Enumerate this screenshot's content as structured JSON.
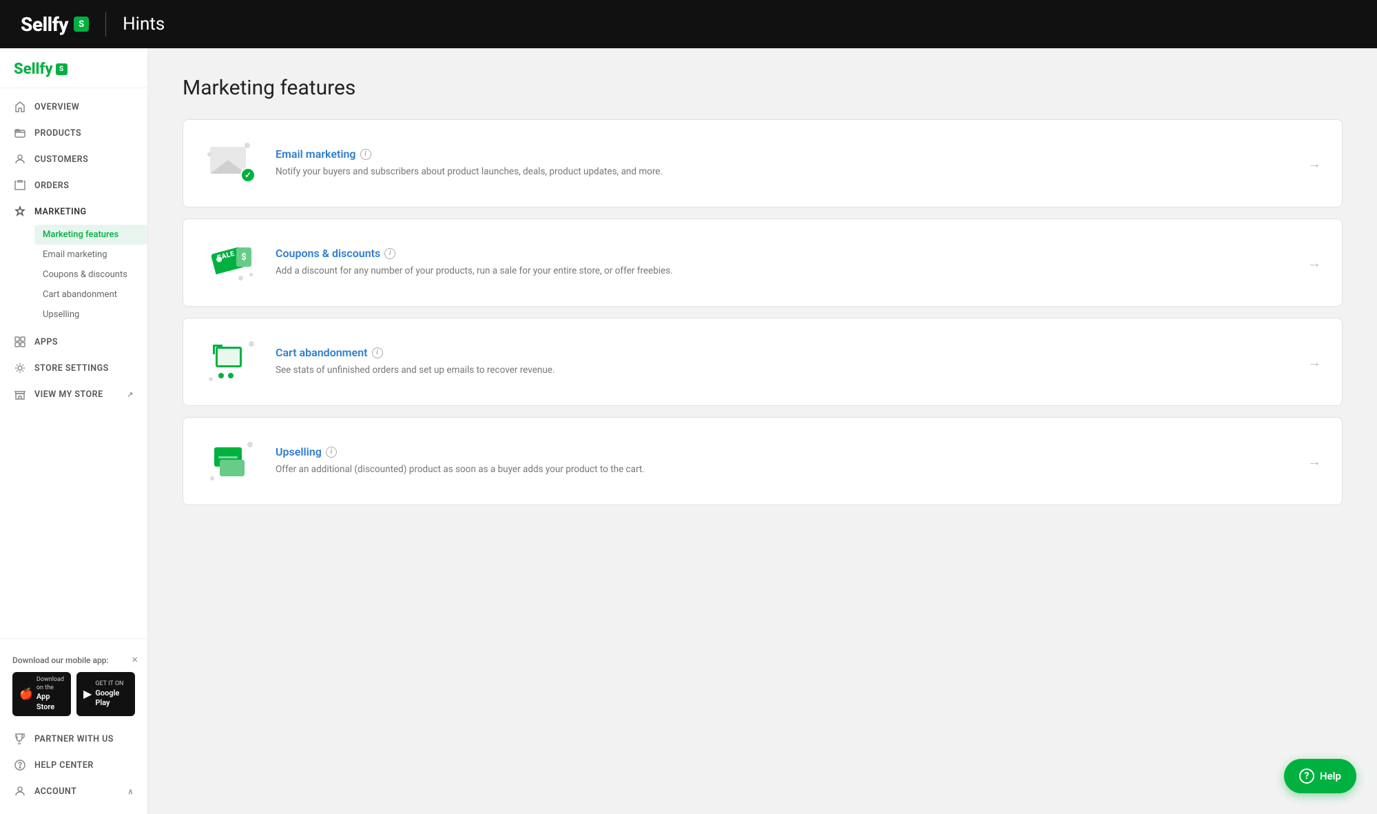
{
  "header": {
    "logo_text": "Sellfy",
    "logo_badge": "S",
    "divider": true,
    "title": "Hints"
  },
  "sidebar": {
    "logo_text": "Sellfy",
    "logo_badge": "S",
    "nav_items": [
      {
        "id": "overview",
        "label": "OVERVIEW",
        "icon": "home-icon"
      },
      {
        "id": "products",
        "label": "PRODUCTS",
        "icon": "folder-icon"
      },
      {
        "id": "customers",
        "label": "CUSTOMERS",
        "icon": "person-icon"
      },
      {
        "id": "orders",
        "label": "ORDERS",
        "icon": "cart-icon"
      },
      {
        "id": "marketing",
        "label": "MARKETING",
        "icon": "bell-icon",
        "active": true
      }
    ],
    "marketing_sub_items": [
      {
        "id": "marketing-features",
        "label": "Marketing features",
        "active": true
      },
      {
        "id": "email-marketing",
        "label": "Email marketing"
      },
      {
        "id": "coupons-discounts",
        "label": "Coupons & discounts"
      },
      {
        "id": "cart-abandonment",
        "label": "Cart abandonment"
      },
      {
        "id": "upselling",
        "label": "Upselling"
      }
    ],
    "bottom_nav": [
      {
        "id": "apps",
        "label": "APPS",
        "icon": "grid-icon"
      },
      {
        "id": "store-settings",
        "label": "STORE SETTINGS",
        "icon": "gear-icon"
      },
      {
        "id": "view-my-store",
        "label": "VIEW MY STORE",
        "icon": "store-icon"
      }
    ],
    "mobile_app": {
      "label": "Download our mobile app:",
      "app_store": {
        "sub": "Download on the",
        "main": "App Store",
        "icon": "🍎"
      },
      "play_store": {
        "sub": "GET IT ON",
        "main": "Google Play",
        "icon": "▶"
      }
    },
    "partner_nav": {
      "label": "PARTNER WITH US",
      "icon": "trophy-icon"
    },
    "help_center_nav": {
      "label": "HELP CENTER",
      "icon": "help-icon"
    },
    "account_nav": {
      "label": "ACCOUNT",
      "icon": "user-icon"
    }
  },
  "main": {
    "page_title": "Marketing features",
    "features": [
      {
        "id": "email-marketing",
        "name": "Email marketing",
        "description": "Notify your buyers and subscribers about product launches, deals, product updates, and more.",
        "icon_type": "email"
      },
      {
        "id": "coupons-discounts",
        "name": "Coupons & discounts",
        "description": "Add a discount for any number of your products, run a sale for your entire store, or offer freebies.",
        "icon_type": "coupon"
      },
      {
        "id": "cart-abandonment",
        "name": "Cart abandonment",
        "description": "See stats of unfinished orders and set up emails to recover revenue.",
        "icon_type": "cart"
      },
      {
        "id": "upselling",
        "name": "Upselling",
        "description": "Offer an additional (discounted) product as soon as a buyer adds your product to the cart.",
        "icon_type": "upsell"
      }
    ]
  },
  "help_button": {
    "label": "Help",
    "icon": "?"
  },
  "colors": {
    "accent": "#00b140",
    "link": "#2e7dd1",
    "header_bg": "#111111"
  }
}
